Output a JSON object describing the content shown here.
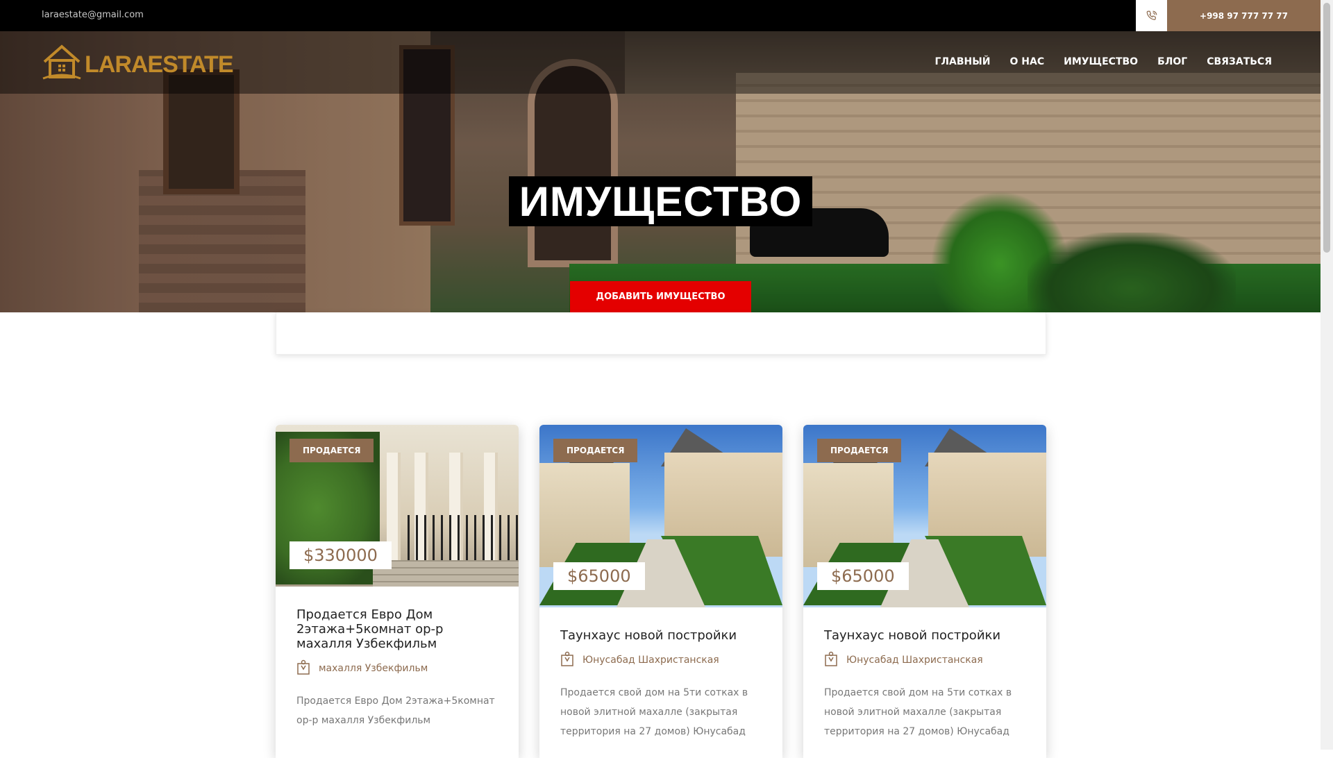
{
  "topbar": {
    "email": "laraestate@gmail.com",
    "phone": "+998 97 777 77 77",
    "phone_icon": "phone-icon"
  },
  "brand": {
    "logo_text": "LARAESTATE",
    "logo_icon": "house-logo-icon",
    "accent_color": "#c18a2a",
    "primary_color": "#8d6b4f"
  },
  "nav": {
    "items": [
      {
        "label": "ГЛАВНЫЙ"
      },
      {
        "label": "О НАС"
      },
      {
        "label": "ИМУЩЕСТВО"
      },
      {
        "label": "БЛОГ"
      },
      {
        "label": "СВЯЗАТЬСЯ"
      }
    ]
  },
  "hero": {
    "title": "ИМУЩЕСТВО",
    "add_button": "ДОБАВИТЬ ИМУЩЕСТВО",
    "add_button_color": "#e40000"
  },
  "listings": [
    {
      "badge": "ПРОДАЕТСЯ",
      "price": "$330000",
      "title": "Продается Евро Дом 2этажа+5комнат ор-р махалля Узбекфильм",
      "location": "махалля Узбекфильм",
      "description": "Продается Евро Дом 2этажа+5комнат ор-р махалля Узбекфильм",
      "location_icon": "map-pin-icon"
    },
    {
      "badge": "ПРОДАЕТСЯ",
      "price": "$65000",
      "title": "Таунхаус новой постройки",
      "location": "Юнусабад Шахристанская",
      "description": "Продается свой дом на 5ти сотках в новой элитной махалле (закрытая территория на 27 домов) Юнусабад",
      "location_icon": "map-pin-icon"
    },
    {
      "badge": "ПРОДАЕТСЯ",
      "price": "$65000",
      "title": "Таунхаус новой постройки",
      "location": "Юнусабад Шахристанская",
      "description": "Продается свой дом на 5ти сотках в новой элитной махалле (закрытая территория на 27 домов) Юнусабад",
      "location_icon": "map-pin-icon"
    }
  ]
}
